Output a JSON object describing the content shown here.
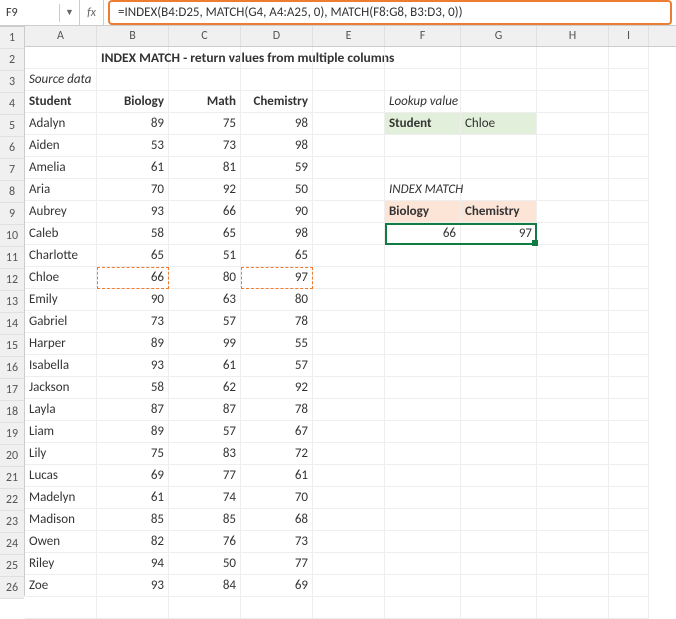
{
  "nameBox": "F9",
  "fxLabel": "fx",
  "formula": "=INDEX(B4:D25, MATCH(G4, A4:A25, 0), MATCH(F8:G8, B3:D3, 0))",
  "title": "INDEX MATCH - return values from multiple columns",
  "sourceLabel": "Source data",
  "headers": {
    "student": "Student",
    "biology": "Biology",
    "math": "Math",
    "chemistry": "Chemistry"
  },
  "rows": [
    {
      "student": "Adalyn",
      "bio": 89,
      "math": 75,
      "chem": 98
    },
    {
      "student": "Aiden",
      "bio": 53,
      "math": 73,
      "chem": 98
    },
    {
      "student": "Amelia",
      "bio": 61,
      "math": 81,
      "chem": 59
    },
    {
      "student": "Aria",
      "bio": 70,
      "math": 92,
      "chem": 50
    },
    {
      "student": "Aubrey",
      "bio": 93,
      "math": 66,
      "chem": 90
    },
    {
      "student": "Caleb",
      "bio": 58,
      "math": 65,
      "chem": 98
    },
    {
      "student": "Charlotte",
      "bio": 65,
      "math": 51,
      "chem": 65
    },
    {
      "student": "Chloe",
      "bio": 66,
      "math": 80,
      "chem": 97
    },
    {
      "student": "Emily",
      "bio": 90,
      "math": 63,
      "chem": 80
    },
    {
      "student": "Gabriel",
      "bio": 73,
      "math": 57,
      "chem": 78
    },
    {
      "student": "Harper",
      "bio": 89,
      "math": 99,
      "chem": 55
    },
    {
      "student": "Isabella",
      "bio": 93,
      "math": 61,
      "chem": 57
    },
    {
      "student": "Jackson",
      "bio": 58,
      "math": 62,
      "chem": 92
    },
    {
      "student": "Layla",
      "bio": 87,
      "math": 87,
      "chem": 78
    },
    {
      "student": "Liam",
      "bio": 89,
      "math": 57,
      "chem": 67
    },
    {
      "student": "Lily",
      "bio": 75,
      "math": 83,
      "chem": 72
    },
    {
      "student": "Lucas",
      "bio": 69,
      "math": 77,
      "chem": 61
    },
    {
      "student": "Madelyn",
      "bio": 61,
      "math": 74,
      "chem": 70
    },
    {
      "student": "Madison",
      "bio": 85,
      "math": 85,
      "chem": 68
    },
    {
      "student": "Owen",
      "bio": 82,
      "math": 76,
      "chem": 73
    },
    {
      "student": "Riley",
      "bio": 94,
      "math": 50,
      "chem": 77
    },
    {
      "student": "Zoe",
      "bio": 93,
      "math": 84,
      "chem": 69
    }
  ],
  "lookupLabel": "Lookup value",
  "lookupHeader": "Student",
  "lookupValue": "Chloe",
  "matchLabel": "INDEX MATCH",
  "resultHeaders": {
    "bio": "Biology",
    "chem": "Chemistry"
  },
  "results": {
    "bio": 66,
    "chem": 97
  },
  "cols": [
    "A",
    "B",
    "C",
    "D",
    "E",
    "F",
    "G",
    "H",
    "I"
  ],
  "rowNums": [
    1,
    2,
    3,
    4,
    5,
    6,
    7,
    8,
    9,
    10,
    11,
    12,
    13,
    14,
    15,
    16,
    17,
    18,
    19,
    20,
    21,
    22,
    23,
    24,
    25,
    26
  ]
}
